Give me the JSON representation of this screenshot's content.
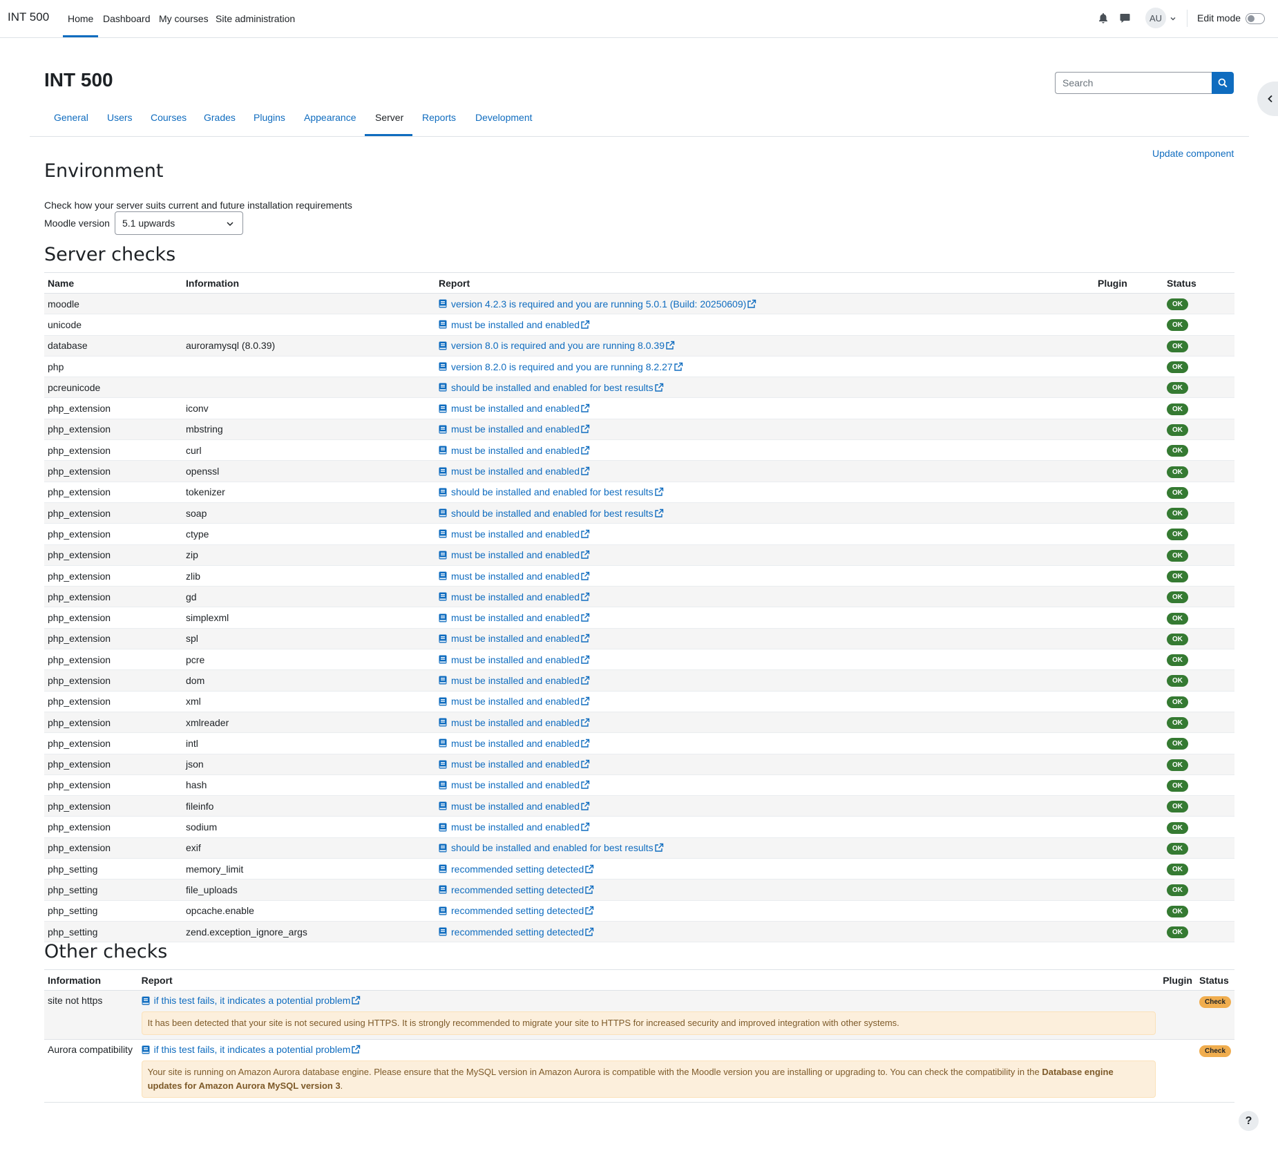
{
  "navbar": {
    "brand": "INT 500",
    "items": [
      "Home",
      "Dashboard",
      "My courses",
      "Site administration"
    ],
    "avatar": "AU",
    "edit_mode": "Edit mode"
  },
  "header": {
    "title": "INT 500",
    "search_placeholder": "Search"
  },
  "tabs": [
    "General",
    "Users",
    "Courses",
    "Grades",
    "Plugins",
    "Appearance",
    "Server",
    "Reports",
    "Development"
  ],
  "update_component": "Update component",
  "environment": {
    "heading": "Environment",
    "description": "Check how your server suits current and future installation requirements",
    "version_label": "Moodle version",
    "version_value": "5.1 upwards"
  },
  "server_checks": {
    "heading": "Server checks",
    "columns": [
      "Name",
      "Information",
      "Report",
      "Plugin",
      "Status"
    ],
    "rows": [
      {
        "name": "moodle",
        "info": "",
        "report": "version 4.2.3 is required and you are running 5.0.1 (Build: 20250609)",
        "status": "OK"
      },
      {
        "name": "unicode",
        "info": "",
        "report": "must be installed and enabled",
        "status": "OK"
      },
      {
        "name": "database",
        "info": "auroramysql (8.0.39)",
        "report": "version 8.0 is required and you are running 8.0.39",
        "status": "OK"
      },
      {
        "name": "php",
        "info": "",
        "report": "version 8.2.0 is required and you are running 8.2.27",
        "status": "OK"
      },
      {
        "name": "pcreunicode",
        "info": "",
        "report": "should be installed and enabled for best results",
        "status": "OK"
      },
      {
        "name": "php_extension",
        "info": "iconv",
        "report": "must be installed and enabled",
        "status": "OK"
      },
      {
        "name": "php_extension",
        "info": "mbstring",
        "report": "must be installed and enabled",
        "status": "OK"
      },
      {
        "name": "php_extension",
        "info": "curl",
        "report": "must be installed and enabled",
        "status": "OK"
      },
      {
        "name": "php_extension",
        "info": "openssl",
        "report": "must be installed and enabled",
        "status": "OK"
      },
      {
        "name": "php_extension",
        "info": "tokenizer",
        "report": "should be installed and enabled for best results",
        "status": "OK"
      },
      {
        "name": "php_extension",
        "info": "soap",
        "report": "should be installed and enabled for best results",
        "status": "OK"
      },
      {
        "name": "php_extension",
        "info": "ctype",
        "report": "must be installed and enabled",
        "status": "OK"
      },
      {
        "name": "php_extension",
        "info": "zip",
        "report": "must be installed and enabled",
        "status": "OK"
      },
      {
        "name": "php_extension",
        "info": "zlib",
        "report": "must be installed and enabled",
        "status": "OK"
      },
      {
        "name": "php_extension",
        "info": "gd",
        "report": "must be installed and enabled",
        "status": "OK"
      },
      {
        "name": "php_extension",
        "info": "simplexml",
        "report": "must be installed and enabled",
        "status": "OK"
      },
      {
        "name": "php_extension",
        "info": "spl",
        "report": "must be installed and enabled",
        "status": "OK"
      },
      {
        "name": "php_extension",
        "info": "pcre",
        "report": "must be installed and enabled",
        "status": "OK"
      },
      {
        "name": "php_extension",
        "info": "dom",
        "report": "must be installed and enabled",
        "status": "OK"
      },
      {
        "name": "php_extension",
        "info": "xml",
        "report": "must be installed and enabled",
        "status": "OK"
      },
      {
        "name": "php_extension",
        "info": "xmlreader",
        "report": "must be installed and enabled",
        "status": "OK"
      },
      {
        "name": "php_extension",
        "info": "intl",
        "report": "must be installed and enabled",
        "status": "OK"
      },
      {
        "name": "php_extension",
        "info": "json",
        "report": "must be installed and enabled",
        "status": "OK"
      },
      {
        "name": "php_extension",
        "info": "hash",
        "report": "must be installed and enabled",
        "status": "OK"
      },
      {
        "name": "php_extension",
        "info": "fileinfo",
        "report": "must be installed and enabled",
        "status": "OK"
      },
      {
        "name": "php_extension",
        "info": "sodium",
        "report": "must be installed and enabled",
        "status": "OK"
      },
      {
        "name": "php_extension",
        "info": "exif",
        "report": "should be installed and enabled for best results",
        "status": "OK"
      },
      {
        "name": "php_setting",
        "info": "memory_limit",
        "report": "recommended setting detected",
        "status": "OK"
      },
      {
        "name": "php_setting",
        "info": "file_uploads",
        "report": "recommended setting detected",
        "status": "OK"
      },
      {
        "name": "php_setting",
        "info": "opcache.enable",
        "report": "recommended setting detected",
        "status": "OK"
      },
      {
        "name": "php_setting",
        "info": "zend.exception_ignore_args",
        "report": "recommended setting detected",
        "status": "OK"
      }
    ]
  },
  "other_checks": {
    "heading": "Other checks",
    "columns": [
      "Information",
      "Report",
      "Plugin",
      "Status"
    ],
    "rows": [
      {
        "info": "site not https",
        "report": "if this test fails, it indicates a potential problem",
        "alert": "It has been detected that your site is not secured using HTTPS. It is strongly recommended to migrate your site to HTTPS for increased security and improved integration with other systems.",
        "status": "Check"
      },
      {
        "info": "Aurora compatibility",
        "report": "if this test fails, it indicates a potential problem",
        "alert_prefix": "Your site is running on Amazon Aurora database engine. Please ensure that the MySQL version in Amazon Aurora is compatible with the Moodle version you are installing or upgrading to. You can check the compatibility in the ",
        "alert_bold": "Database engine updates for Amazon Aurora MySQL version 3",
        "alert_suffix": ".",
        "status": "Check"
      }
    ]
  },
  "help_label": "?",
  "colors": {
    "link": "#0f6cbf",
    "ok": "#357a32",
    "check": "#f0ad4e",
    "alert_bg": "#fcefdc"
  }
}
